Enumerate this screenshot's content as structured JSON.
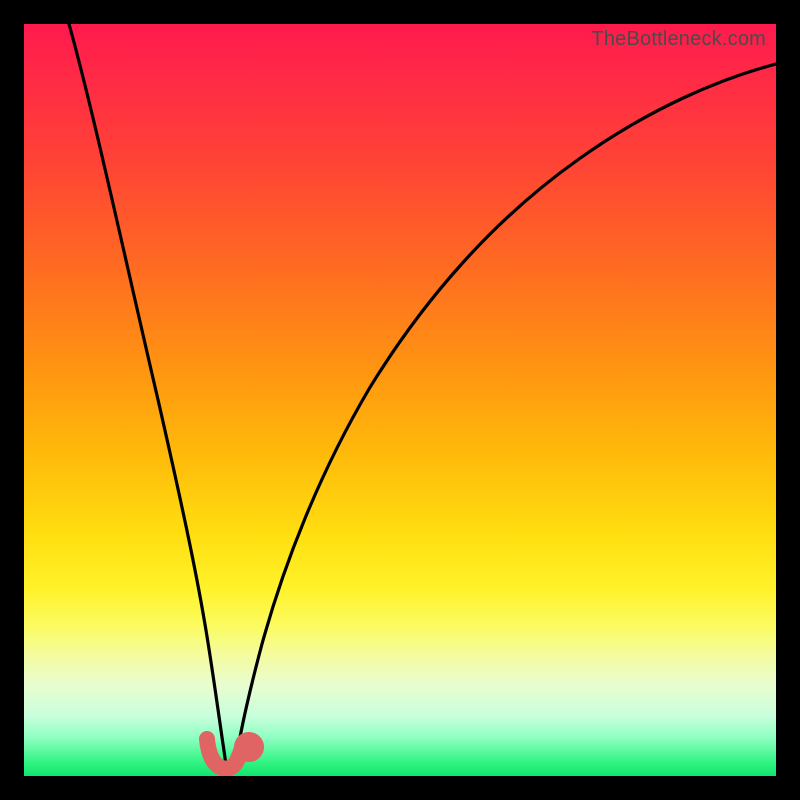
{
  "watermark": "TheBottleneck.com",
  "chart_data": {
    "type": "line",
    "title": "",
    "xlabel": "",
    "ylabel": "",
    "xlim": [
      0,
      100
    ],
    "ylim": [
      0,
      100
    ],
    "background_gradient": {
      "top": "#ff1a4d",
      "mid_upper": "#ff9212",
      "mid": "#ffdf10",
      "mid_lower": "#fbfb60",
      "bottom": "#10e66e"
    },
    "series": [
      {
        "name": "left-branch",
        "color": "#000000",
        "x": [
          6,
          9,
          12,
          15,
          18,
          20,
          22,
          23.5,
          24.5,
          25.2
        ],
        "y": [
          100,
          85,
          68,
          50,
          32,
          20,
          11,
          5,
          2,
          0.5
        ]
      },
      {
        "name": "right-branch",
        "color": "#000000",
        "x": [
          26.5,
          28,
          30,
          33,
          37,
          42,
          48,
          55,
          63,
          72,
          82,
          93,
          100
        ],
        "y": [
          0.5,
          4,
          10,
          20,
          33,
          46,
          57,
          67,
          75,
          82,
          87.5,
          92,
          94.5
        ]
      },
      {
        "name": "highlight-blob",
        "color": "#e06464",
        "x": [
          23.2,
          23.5,
          24.0,
          24.6,
          25.2,
          25.9,
          26.5,
          27.0,
          27.2,
          27.6,
          28.2
        ],
        "y": [
          3.8,
          2.4,
          1.4,
          0.9,
          0.7,
          0.9,
          1.4,
          2.3,
          3.2,
          4.0,
          4.4
        ]
      }
    ]
  }
}
